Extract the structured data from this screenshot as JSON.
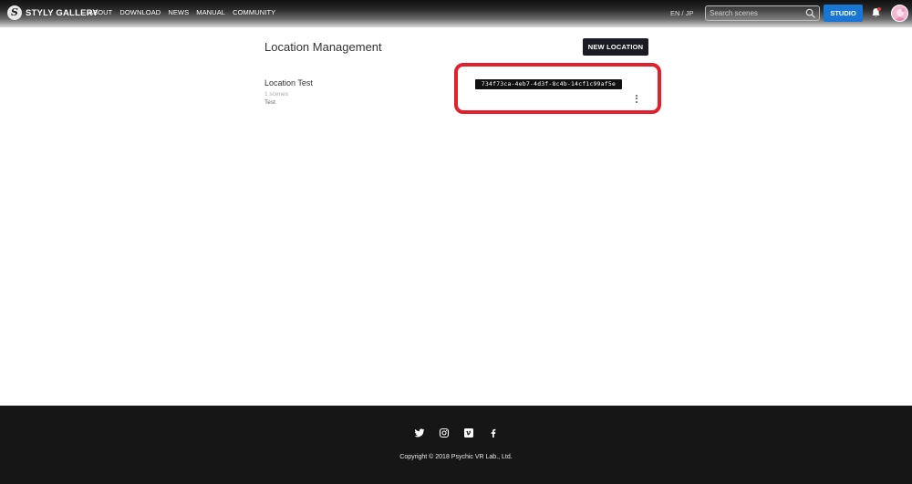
{
  "header": {
    "logo_letter": "S",
    "logo_text": "STYLY GALLERY",
    "nav": [
      {
        "label": "ABOUT"
      },
      {
        "label": "DOWNLOAD"
      },
      {
        "label": "NEWS"
      },
      {
        "label": "MANUAL"
      },
      {
        "label": "COMMUNITY"
      }
    ],
    "lang_en": "EN",
    "lang_sep": " / ",
    "lang_jp": "JP",
    "search_placeholder": "Search scenes",
    "search_value": "",
    "studio_label": "STUDIO",
    "icons": {
      "search": "search-icon",
      "bell": "bell-icon",
      "avatar": "avatar"
    }
  },
  "main": {
    "title": "Location Management",
    "new_location_label": "NEW LOCATION",
    "location": {
      "name": "Location Test",
      "scenes": "1 scenes",
      "description": "Test",
      "id": "734f73ca-4eb7-4d3f-8c4b-14cf1c99af5e"
    },
    "highlight_color": "#e0202d"
  },
  "footer": {
    "social": [
      {
        "name": "twitter-icon"
      },
      {
        "name": "instagram-icon"
      },
      {
        "name": "vimeo-icon"
      },
      {
        "name": "facebook-icon"
      }
    ],
    "copyright": "Copyright © 2018 Psychic VR Lab., Ltd."
  },
  "colors": {
    "studio_button": "#1976d2",
    "new_location_button": "#1b1b24",
    "footer_bg": "#161616",
    "notification_dot": "#e53935"
  }
}
